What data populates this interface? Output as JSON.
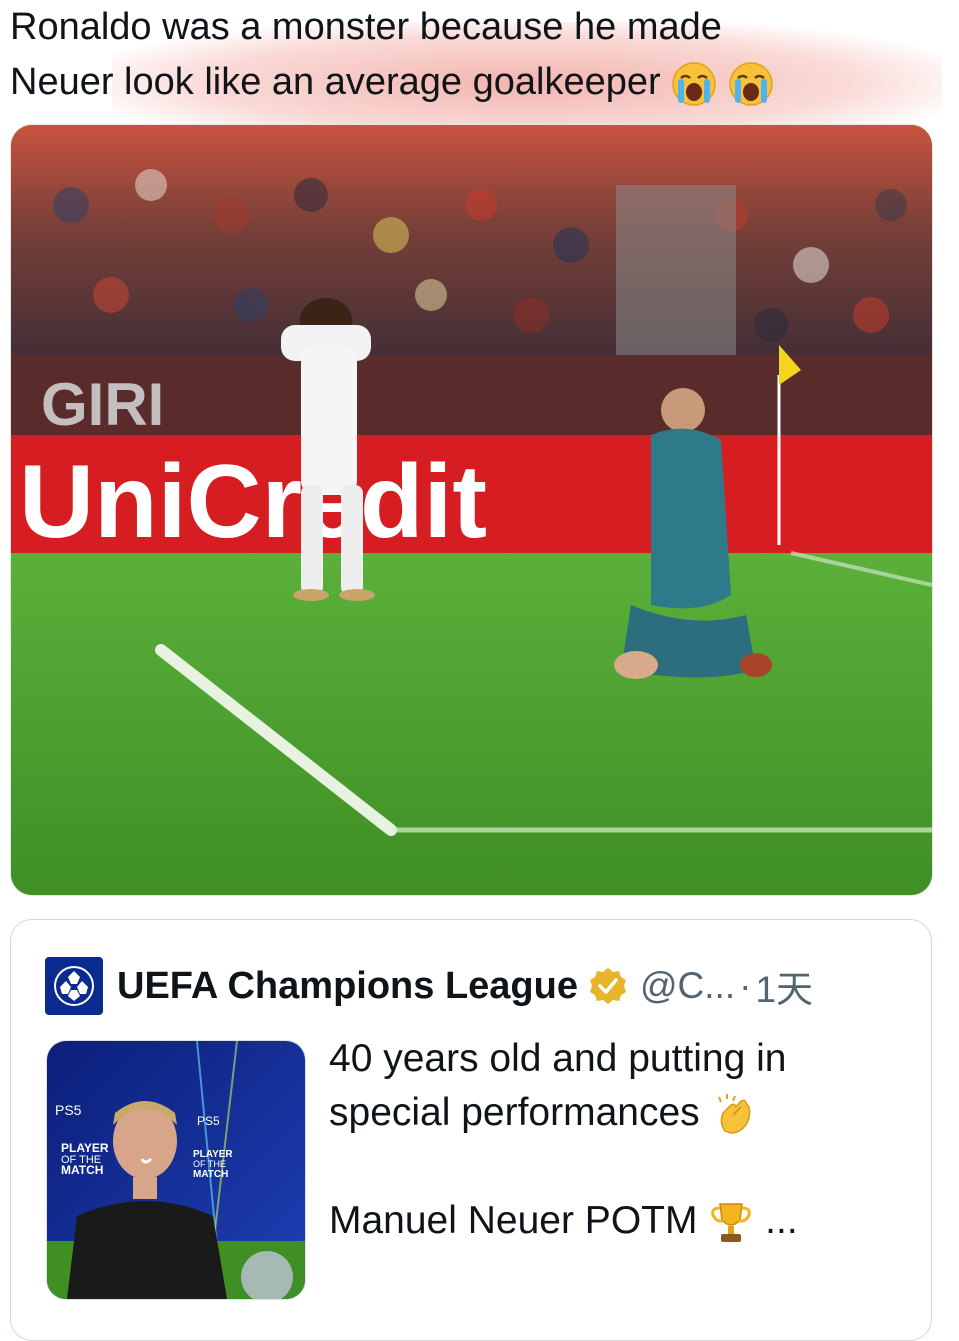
{
  "tweet": {
    "text_line1": "Ronaldo was a monster because he made",
    "text_line2": "Neuer look like an average goalkeeper",
    "emojis": [
      "loudly-crying-face",
      "loudly-crying-face"
    ]
  },
  "video": {
    "banner_top": "GIRI",
    "banner_main": "UniCredit",
    "mute_icon": "muted-speaker-icon"
  },
  "quoted": {
    "name": "UEFA Champions League",
    "verified": "gold-check-badge",
    "handle": "@C...",
    "separator": "·",
    "time": "1天",
    "text_line1": "40 years old and putting in",
    "text_line2": "special performances",
    "text_line3": "Manuel Neuer POTM",
    "ellipsis": "...",
    "thumb": {
      "brand": "PS5",
      "potm_line1": "PLAYER",
      "potm_line2": "OF THE",
      "potm_line3": "MATCH"
    }
  },
  "colors": {
    "text": "#0f1419",
    "muted": "#536471",
    "border": "#cfd9de",
    "uefa_blue": "#0b2a8f",
    "verified_gold": "#e8b429"
  }
}
